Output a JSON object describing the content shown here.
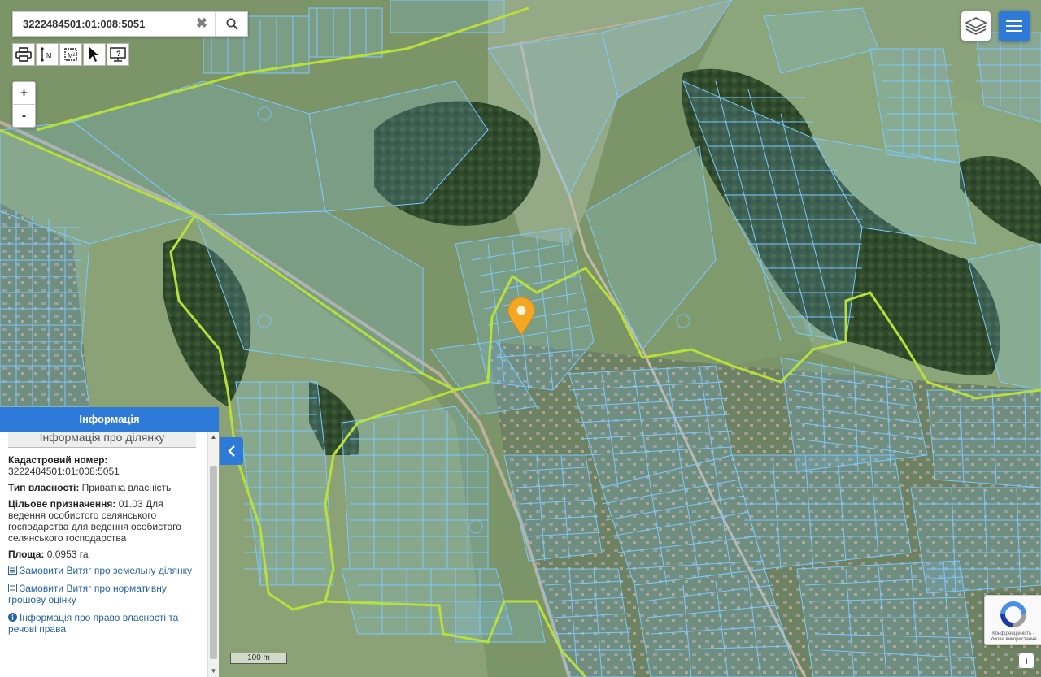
{
  "search": {
    "value": "3222484501:01:008:5051",
    "clear_symbol": "✖"
  },
  "toolbar": {
    "tools": [
      "print-icon",
      "measure-distance-icon",
      "measure-area-icon",
      "pointer-icon",
      "info-screen-icon"
    ],
    "measure_label": "M",
    "area_label": "M²"
  },
  "zoom": {
    "in": "+",
    "out": "-"
  },
  "panel": {
    "header": "Інформація",
    "subtitle": "Інформація про ділянку",
    "cadastral_label": "Кадастровий номер:",
    "cadastral_value": "3222484501:01:008:5051",
    "ownership_label": "Тип власності:",
    "ownership_value": "Приватна власність",
    "purpose_label": "Цільове призначення:",
    "purpose_value": "01.03 Для ведення особистого селянського господарства для ведення особистого селянського господарства",
    "area_label": "Площа:",
    "area_value": "0.0953 га",
    "links": [
      "Замовити Витяг про земельну ділянку",
      "Замовити Витяг про нормативну грошову оцінку",
      "Інформація про право власності та речові права"
    ]
  },
  "scale_label": "100 m",
  "captcha_text": "Конфіденційність - Умови використання",
  "colors": {
    "accent": "#2e7ad9",
    "parcel_line": "#7ec8ff",
    "boundary_line": "#b7e03a",
    "marker": "#f5a623"
  }
}
